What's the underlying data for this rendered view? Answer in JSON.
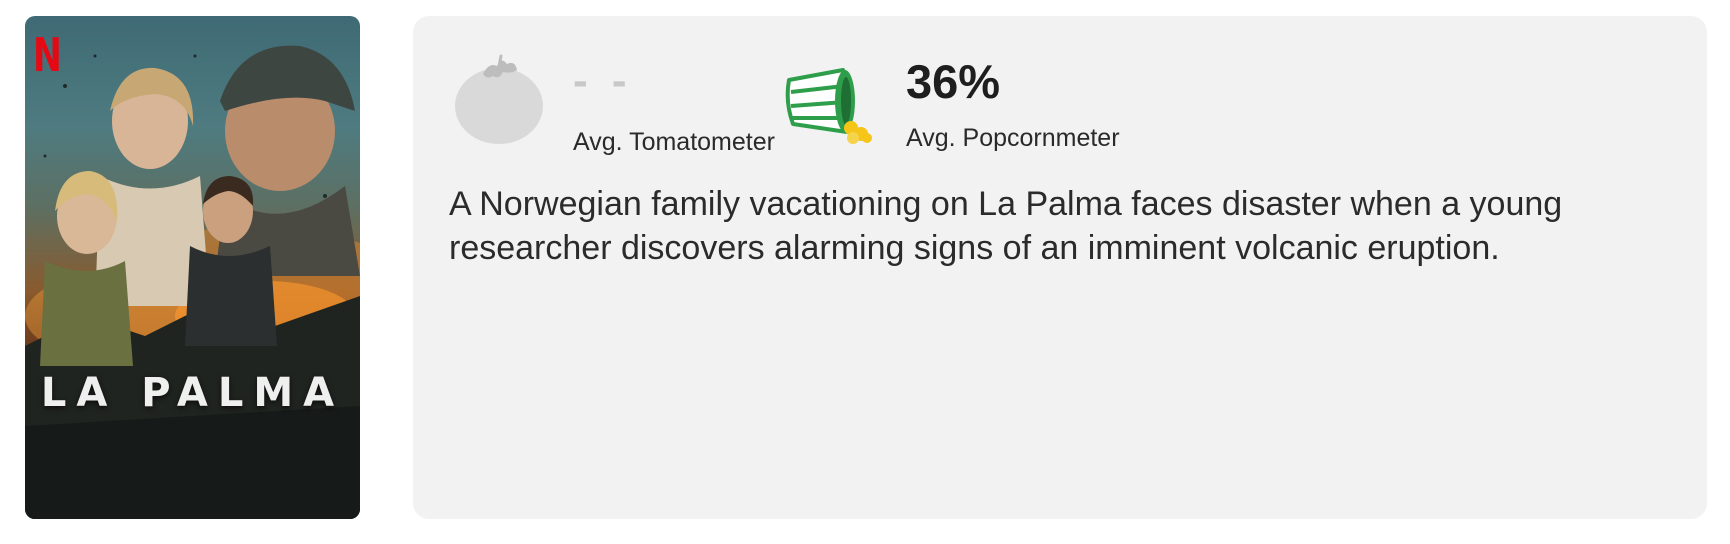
{
  "poster": {
    "title_text": "LA PALMA",
    "badge_text": "N",
    "colors": {
      "netflix_red": "#e50914"
    }
  },
  "ratings": {
    "tomatometer": {
      "score": "- -",
      "label": "Avg. Tomatometer",
      "icon": "tomato-icon"
    },
    "popcornmeter": {
      "score": "36%",
      "label": "Avg. Popcornmeter",
      "icon": "popcorn-bucket-icon"
    }
  },
  "description": "A Norwegian family vacationing on La Palma faces disaster when a young researcher discovers alarming signs of an imminent volcanic eruption.",
  "colors": {
    "card_background": "#f2f2f2",
    "tomato_gray": "#d9d9d9",
    "popcorn_green": "#2e9e4a",
    "popcorn_yellow": "#f5c518"
  }
}
